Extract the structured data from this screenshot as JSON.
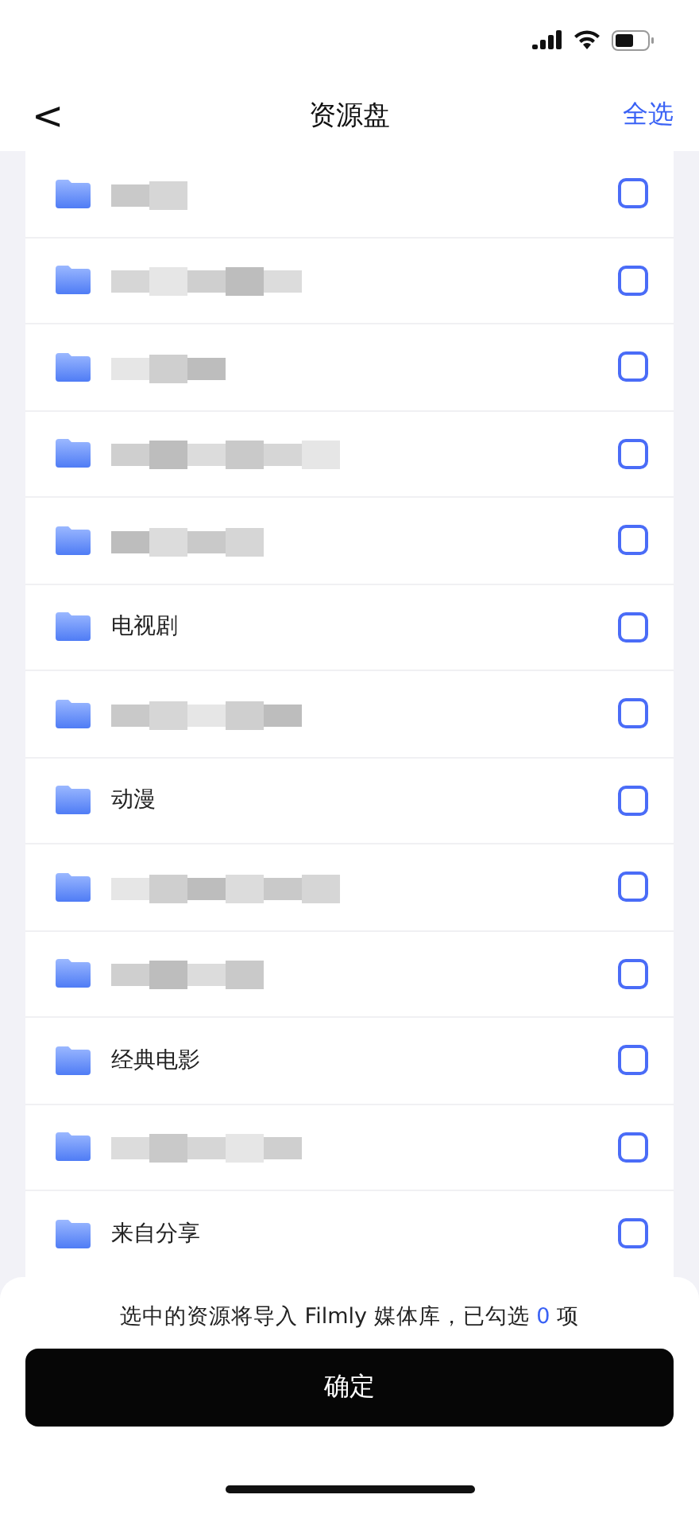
{
  "nav": {
    "back": "<",
    "title": "资源盘",
    "action": "全选"
  },
  "rows": [
    {
      "kind": "blurred",
      "checked": false
    },
    {
      "kind": "blurred",
      "checked": false
    },
    {
      "kind": "blurred",
      "checked": false
    },
    {
      "kind": "blurred",
      "checked": false
    },
    {
      "kind": "blurred",
      "checked": false
    },
    {
      "kind": "folder",
      "name": "电视剧",
      "checked": false
    },
    {
      "kind": "blurred",
      "checked": false
    },
    {
      "kind": "folder",
      "name": "动漫",
      "checked": false
    },
    {
      "kind": "blurred",
      "checked": false
    },
    {
      "kind": "blurred",
      "checked": false
    },
    {
      "kind": "folder",
      "name": "经典电影",
      "checked": false
    },
    {
      "kind": "blurred",
      "checked": false
    },
    {
      "kind": "folder",
      "name": "来自分享",
      "checked": false
    }
  ],
  "footer": {
    "note_before": "选中的资源将导入 Filmly 媒体库，已勾选",
    "count": "0",
    "note_after": "项",
    "confirm": "确定"
  }
}
